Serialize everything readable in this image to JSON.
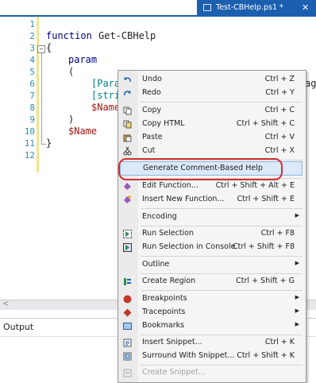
{
  "tab": {
    "title": "Test-CBHelp.ps1 *",
    "close": "✕"
  },
  "editor": {
    "line_numbers": [
      "1",
      "2",
      "3",
      "4",
      "5",
      "6",
      "7",
      "8",
      "9",
      "10",
      "11",
      "12"
    ],
    "lines": {
      "l2_kw": "function",
      "l2_name": "Get-CBHelp",
      "l3": "{",
      "l4": "param",
      "l5": "(",
      "l6": "[Param",
      "l6_right": "age",
      "l7": "[strin",
      "l8": "$Name",
      "l9": ")",
      "l10": "$Name",
      "l11": "}"
    }
  },
  "output": {
    "label": "Output"
  },
  "menu": {
    "items": [
      {
        "label": "Undo",
        "shortcut": "Ctrl + Z",
        "icon": "undo-icon"
      },
      {
        "label": "Redo",
        "shortcut": "Ctrl + Y",
        "icon": "redo-icon"
      },
      {
        "label": "Copy",
        "shortcut": "Ctrl + C",
        "icon": "copy-icon"
      },
      {
        "label": "Copy HTML",
        "shortcut": "Ctrl + Shift +  C",
        "icon": "copy-html-icon"
      },
      {
        "label": "Paste",
        "shortcut": "Ctrl + V",
        "icon": "paste-icon"
      },
      {
        "label": "Cut",
        "shortcut": "Ctrl + X",
        "icon": "cut-icon"
      },
      {
        "label": "Generate Comment-Based Help",
        "shortcut": "",
        "icon": ""
      },
      {
        "label": "Edit Function...",
        "shortcut": "Ctrl + Shift + Alt + E",
        "icon": "edit-function-icon"
      },
      {
        "label": "Insert New Function...",
        "shortcut": "Ctrl + Shift + E",
        "icon": "insert-function-icon"
      },
      {
        "label": "Encoding",
        "shortcut": "",
        "icon": ""
      },
      {
        "label": "Run Selection",
        "shortcut": "Ctrl + F8",
        "icon": "run-selection-icon"
      },
      {
        "label": "Run Selection in Console",
        "shortcut": "Ctrl + Shift + F8",
        "icon": "run-console-icon"
      },
      {
        "label": "Outline",
        "shortcut": "",
        "icon": ""
      },
      {
        "label": "Create Region",
        "shortcut": "Ctrl + Shift + G",
        "icon": "region-icon"
      },
      {
        "label": "Breakpoints",
        "shortcut": "",
        "icon": "breakpoint-icon"
      },
      {
        "label": "Tracepoints",
        "shortcut": "",
        "icon": "tracepoint-icon"
      },
      {
        "label": "Bookmarks",
        "shortcut": "",
        "icon": "bookmark-icon"
      },
      {
        "label": "Insert Snippet...",
        "shortcut": "Ctrl + K",
        "icon": "snippet-icon"
      },
      {
        "label": "Surround With Snippet...",
        "shortcut": "Ctrl + Shift + K",
        "icon": "surround-snippet-icon"
      },
      {
        "label": "Create Snippet...",
        "shortcut": "",
        "icon": "create-snippet-icon"
      }
    ],
    "submenu_arrow": "▶"
  },
  "colors": {
    "accent": "#1c5fb0",
    "highlight_ring": "#d32f2f",
    "keyword": "#00008b",
    "variable": "#a31515",
    "type": "#008080",
    "line_number": "#2b91af"
  }
}
